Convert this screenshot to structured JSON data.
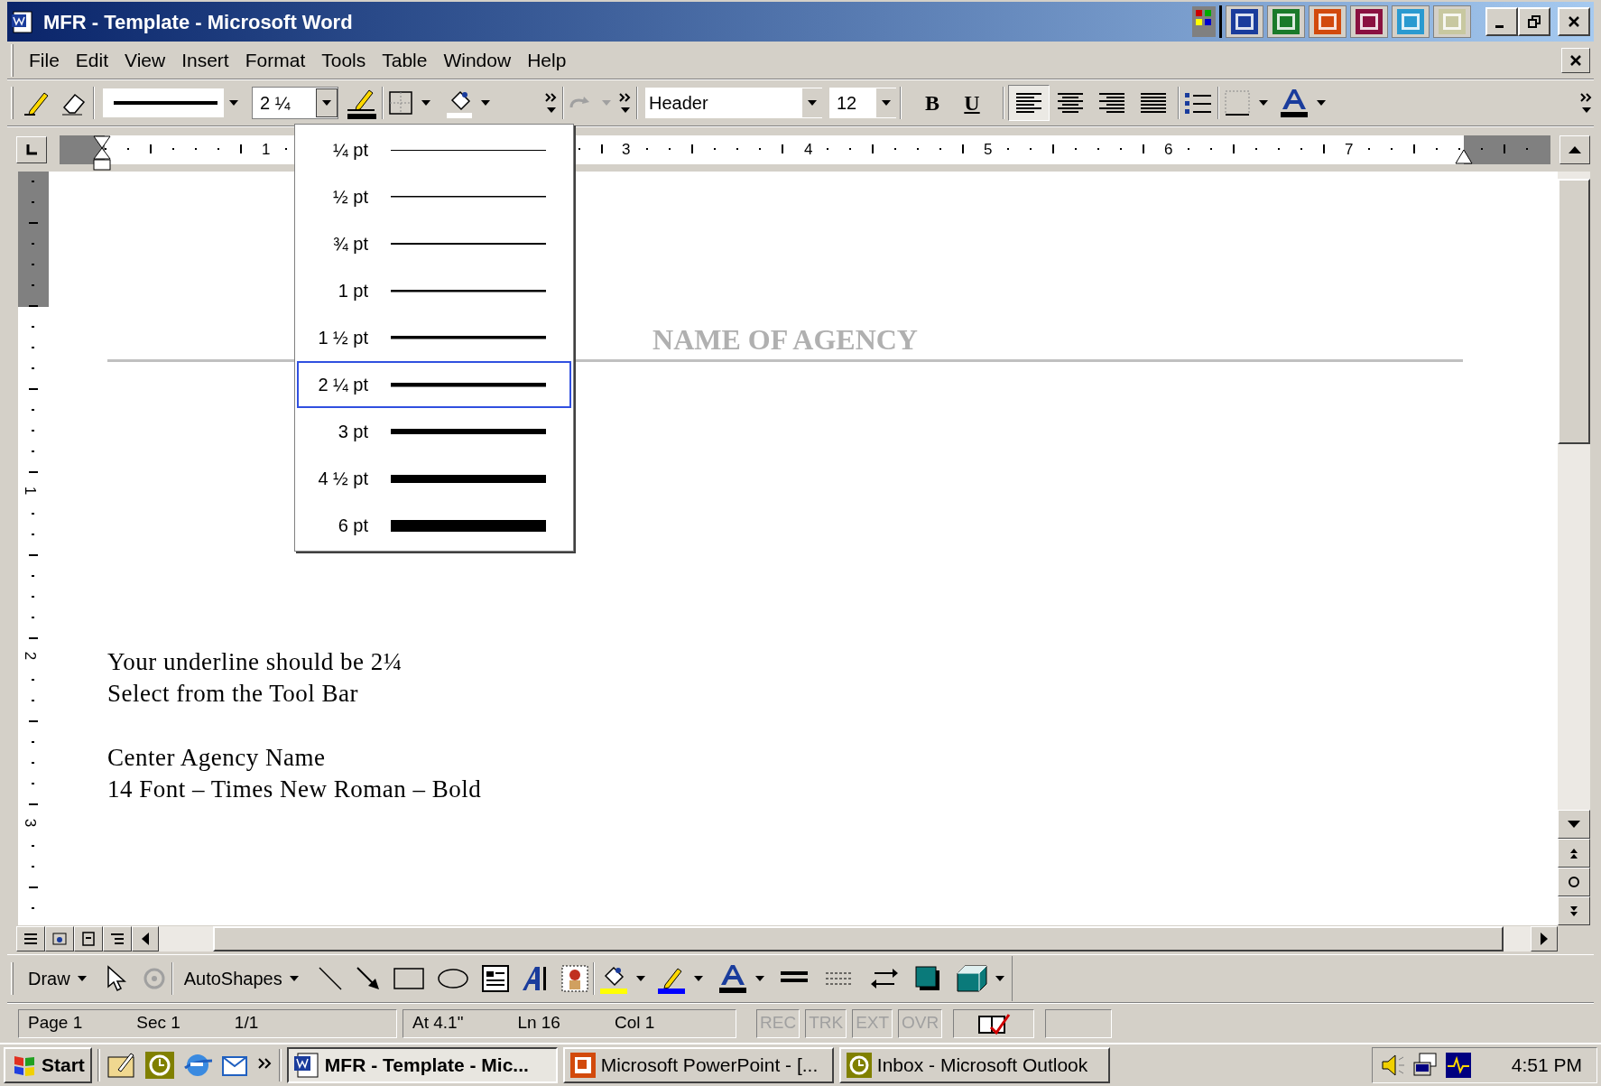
{
  "window": {
    "title": "MFR - Template - Microsoft Word"
  },
  "menu_bar": [
    {
      "label": "File"
    },
    {
      "label": "Edit"
    },
    {
      "label": "View"
    },
    {
      "label": "Insert"
    },
    {
      "label": "Format"
    },
    {
      "label": "Tools"
    },
    {
      "label": "Table"
    },
    {
      "label": "Window"
    },
    {
      "label": "Help"
    }
  ],
  "toolbar": {
    "line_weight": "2 ¼",
    "style": "Header",
    "font_size": "12",
    "bold": "B",
    "underline": "U",
    "alignment": [
      {
        "kind": "left",
        "selected": true
      },
      {
        "kind": "center",
        "selected": false
      },
      {
        "kind": "right",
        "selected": false
      },
      {
        "kind": "justify",
        "selected": false
      }
    ]
  },
  "ruler": {
    "numbers": [
      "1",
      "3",
      "4",
      "5",
      "6",
      "7"
    ]
  },
  "vertical_ruler": {
    "numbers": [
      "1",
      "2",
      "3"
    ]
  },
  "line_weight_menu": [
    {
      "label": "¼ pt",
      "selected": false
    },
    {
      "label": "½ pt",
      "selected": false
    },
    {
      "label": "¾ pt",
      "selected": false
    },
    {
      "label": "1 pt",
      "selected": false
    },
    {
      "label": "1 ½ pt",
      "selected": false
    },
    {
      "label": "2 ¼ pt",
      "selected": true
    },
    {
      "label": "3 pt",
      "selected": false
    },
    {
      "label": "4 ½ pt",
      "selected": false
    },
    {
      "label": "6 pt",
      "selected": false
    }
  ],
  "document": {
    "heading": "NAME OF AGENCY",
    "blocks": [
      {
        "lines": [
          "Your underline should be 2¼",
          "Select from the Tool Bar"
        ]
      },
      {
        "lines": [
          "Center Agency Name",
          "14 Font – Times New Roman – Bold"
        ]
      }
    ]
  },
  "drawing_toolbar": {
    "draw": {
      "label": "Draw"
    },
    "autoshapes": {
      "label": "AutoShapes"
    }
  },
  "status_bar": {
    "groups": [
      [
        "Page 1",
        "Sec 1",
        "1/1"
      ],
      [
        "At 4.1\"",
        "Ln 16",
        "Col 1"
      ]
    ],
    "modes": [
      {
        "label": "REC",
        "disabled": true
      },
      {
        "label": "TRK",
        "disabled": true
      },
      {
        "label": "EXT",
        "disabled": true
      },
      {
        "label": "OVR",
        "disabled": true
      }
    ]
  },
  "taskbar": {
    "start": "Start",
    "tasks": [
      {
        "label": "MFR - Template - Mic...",
        "selected": true,
        "kind": "word"
      },
      {
        "label": "Microsoft PowerPoint - [...",
        "selected": false,
        "kind": "powerpoint"
      },
      {
        "label": "Inbox - Microsoft Outlook",
        "selected": false,
        "kind": "outlook"
      }
    ],
    "clock": "4:51 PM"
  }
}
